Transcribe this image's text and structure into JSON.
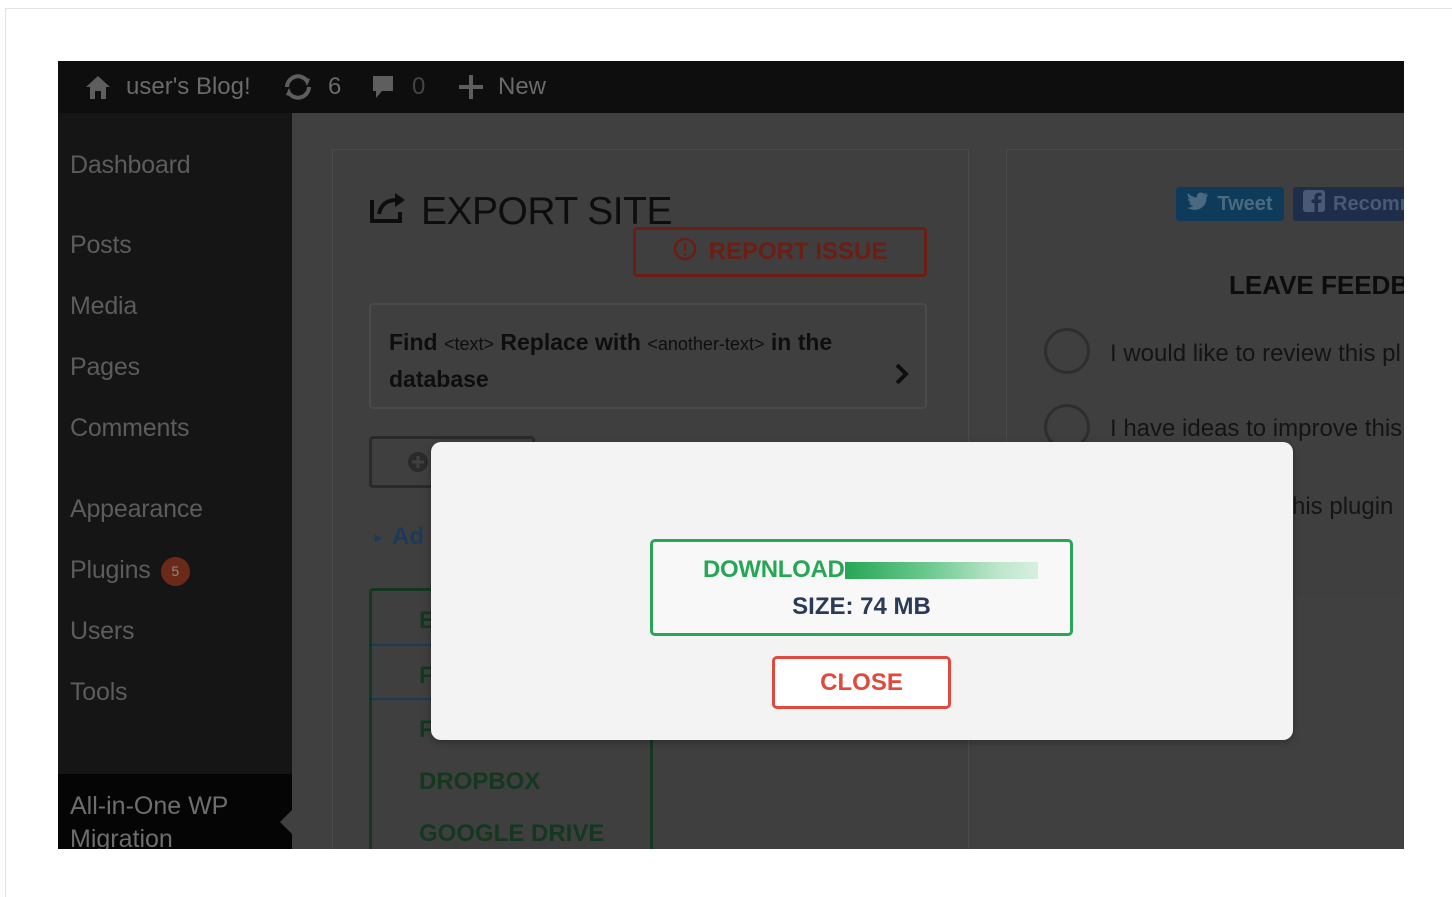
{
  "admin_bar": {
    "site_name": "user's Blog!",
    "updates_count": "6",
    "comments_count": "0",
    "new_label": "New"
  },
  "sidebar": {
    "items": [
      {
        "label": "Dashboard"
      },
      {
        "label": "Posts"
      },
      {
        "label": "Media"
      },
      {
        "label": "Pages"
      },
      {
        "label": "Comments"
      },
      {
        "label": "Appearance"
      },
      {
        "label": "Plugins",
        "badge": "5"
      },
      {
        "label": "Users"
      },
      {
        "label": "Tools"
      }
    ],
    "active_item": "All-in-One WP Migration"
  },
  "export_panel": {
    "title": "EXPORT SITE",
    "report_issue": "REPORT ISSUE",
    "find_replace": {
      "find": "Find",
      "text_token": "<text>",
      "replace_with": "Replace with",
      "another_token": "<another-text>",
      "in_the": "in the",
      "database": "database"
    },
    "advanced_partial": "Ad",
    "export_options": [
      {
        "label": "E"
      },
      {
        "label": "F"
      },
      {
        "label": "F"
      },
      {
        "label": "DROPBOX"
      },
      {
        "label": "GOOGLE DRIVE"
      }
    ]
  },
  "feedback_panel": {
    "tweet_label": "Tweet",
    "recommend_label": "Recomm",
    "heading": "LEAVE FEEDB",
    "options": [
      {
        "text": "I would like to review this pl"
      },
      {
        "text": "I have ideas to improve this"
      },
      {
        "text": "his plugin"
      }
    ]
  },
  "modal": {
    "download_label": "DOWNLOAD",
    "download_progress": 1.0,
    "size_text": "SIZE: 74 MB",
    "close_label": "CLOSE"
  },
  "colors": {
    "accent_green": "#27a655",
    "danger_red": "#e0493b",
    "size_text": "#2b3a55"
  }
}
